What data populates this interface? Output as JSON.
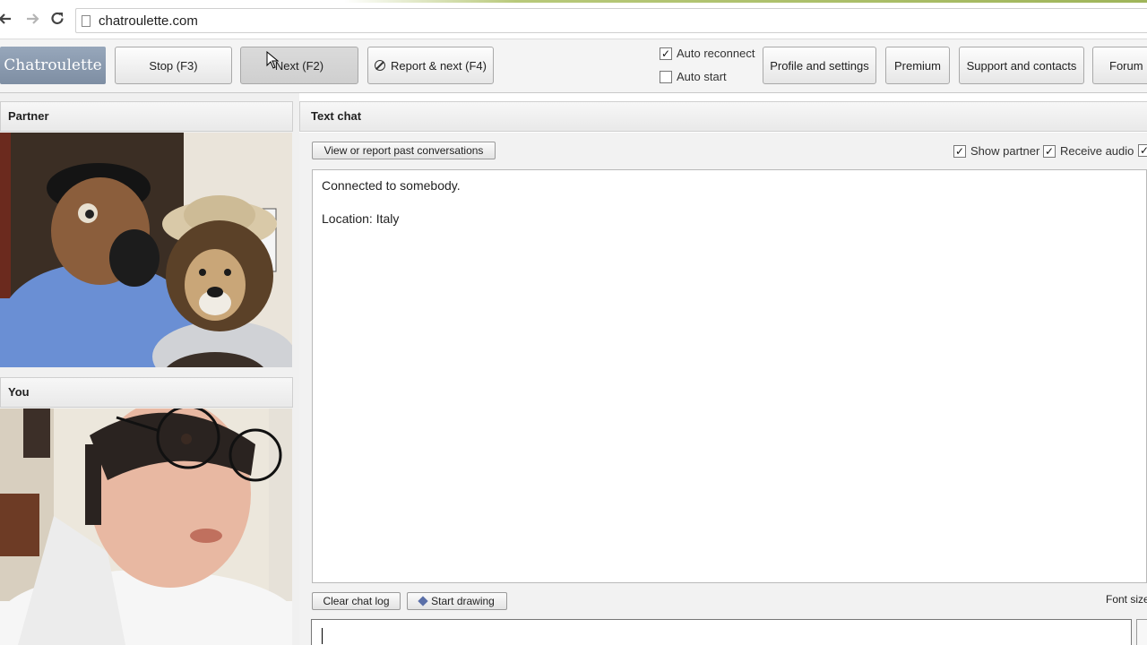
{
  "browser": {
    "url": "chatroulette.com",
    "back_icon": "back-arrow-icon",
    "forward_icon": "forward-arrow-icon",
    "reload_icon": "reload-icon"
  },
  "toolbar": {
    "logo": "Chatroulette",
    "stop_label": "Stop (F3)",
    "next_label": "Next (F2)",
    "report_label": "Report & next (F4)",
    "auto_reconnect_label": "Auto reconnect",
    "auto_reconnect_checked": true,
    "auto_start_label": "Auto start",
    "auto_start_checked": false,
    "profile_label": "Profile and settings",
    "premium_label": "Premium",
    "support_label": "Support and contacts",
    "forum_label": "Forum"
  },
  "left": {
    "partner_title": "Partner",
    "you_title": "You"
  },
  "chat": {
    "title": "Text chat",
    "past_label": "View or report past conversations",
    "show_partner_label": "Show partner",
    "receive_audio_label": "Receive audio",
    "messages": [
      "Connected to somebody.",
      "Location: Italy"
    ],
    "clear_label": "Clear chat log",
    "draw_label": "Start drawing",
    "font_size_label": "Font size"
  },
  "colors": {
    "logo_bg": "#8898ad",
    "toolbar_bg": "#f4f4f4",
    "panel_bg": "#f2f2f2"
  }
}
